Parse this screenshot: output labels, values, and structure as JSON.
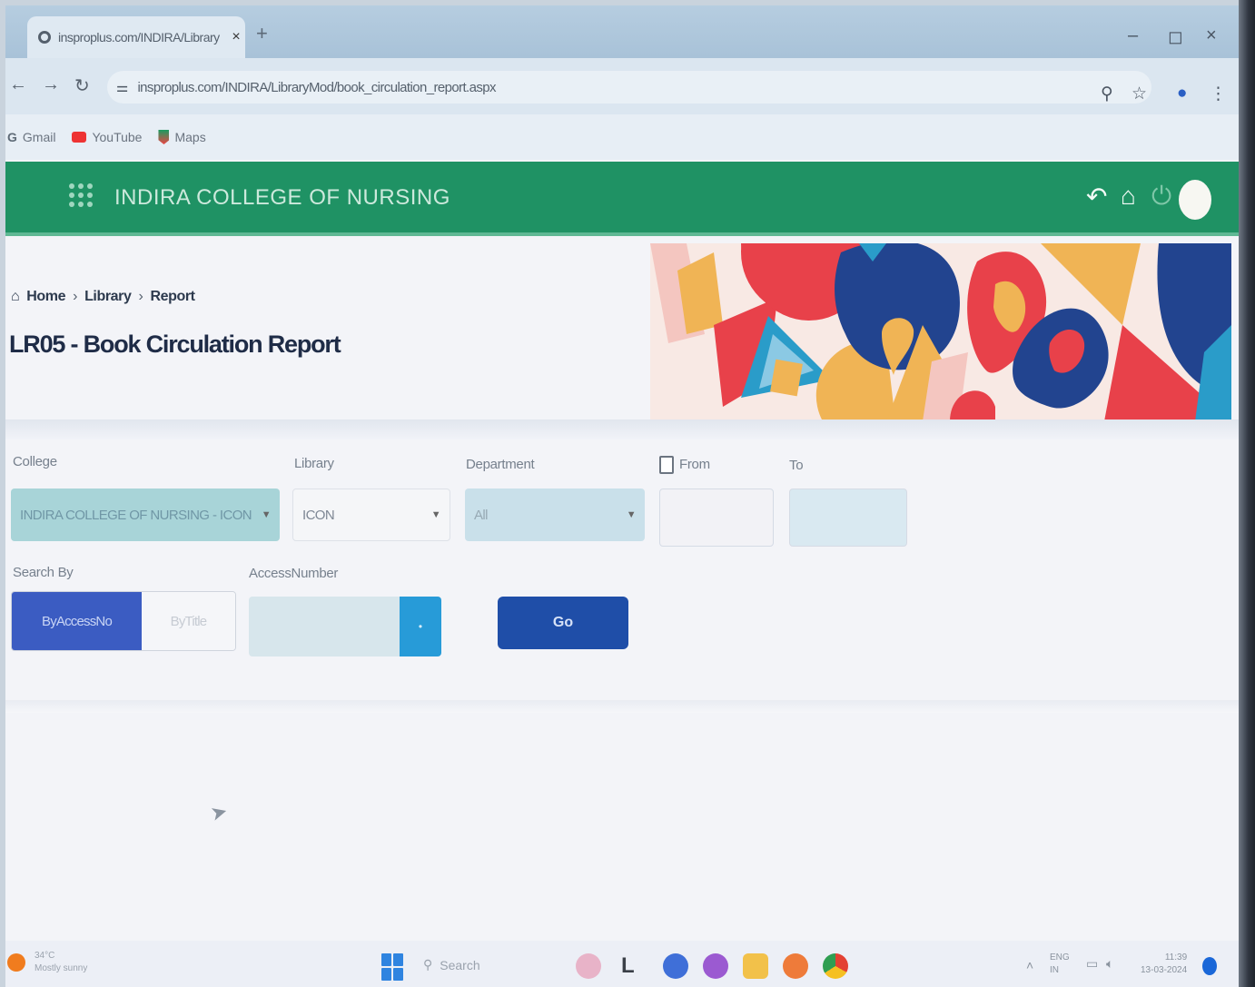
{
  "browser": {
    "tab_title": "insproplus.com/INDIRA/Library",
    "tab_close": "×",
    "new_tab": "+",
    "minimize": "–",
    "restore": "◻",
    "close": "×",
    "url": "insproplus.com/INDIRA/LibraryMod/book_circulation_report.aspx",
    "bookmarks": [
      "Gmail",
      "YouTube",
      "Maps"
    ]
  },
  "app": {
    "name": "INDIRA COLLEGE OF NURSING",
    "header_color": "#1f9264"
  },
  "breadcrumb": [
    "Home",
    "Library",
    "Report"
  ],
  "page_title": "LR05 - Book Circulation Report",
  "form": {
    "college_label": "College",
    "college_value": "INDIRA COLLEGE OF NURSING - ICON",
    "library_label": "Library",
    "library_value": "ICON",
    "department_label": "Department",
    "department_value": "All",
    "from_label": "From",
    "to_label": "To",
    "search_by_label": "Search By",
    "search_by_options": [
      "ByAccessNo",
      "ByTitle"
    ],
    "search_by_selected": "ByAccessNo",
    "access_number_label": "AccessNumber",
    "go_label": "Go"
  },
  "taskbar": {
    "weather_temp": "34°C",
    "weather_desc": "Mostly sunny",
    "search_label": "Search",
    "lang": "ENG",
    "region": "IN",
    "time": "11:39",
    "date": "13-03-2024"
  }
}
